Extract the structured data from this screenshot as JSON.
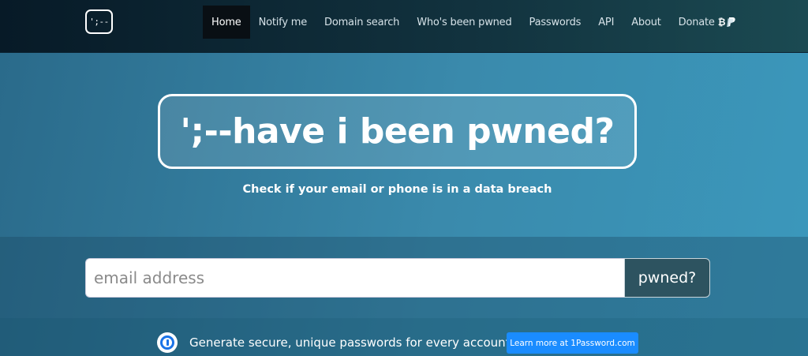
{
  "logo": {
    "text": "';--"
  },
  "nav": {
    "items": [
      {
        "label": "Home",
        "active": true
      },
      {
        "label": "Notify me",
        "active": false
      },
      {
        "label": "Domain search",
        "active": false
      },
      {
        "label": "Who's been pwned",
        "active": false
      },
      {
        "label": "Passwords",
        "active": false
      },
      {
        "label": "API",
        "active": false
      },
      {
        "label": "About",
        "active": false
      },
      {
        "label": "Donate",
        "active": false,
        "icons": [
          "bitcoin-icon",
          "paypal-icon"
        ]
      }
    ]
  },
  "hero": {
    "title": "';--have i been pwned?",
    "subtitle": "Check if your email or phone is in a data breach"
  },
  "search": {
    "placeholder": "email address",
    "value": "",
    "button_label": "pwned?"
  },
  "promo": {
    "text": "Generate secure, unique passwords for every account",
    "button_label": "Learn more at 1Password.com",
    "button_color": "#1a8cff"
  }
}
